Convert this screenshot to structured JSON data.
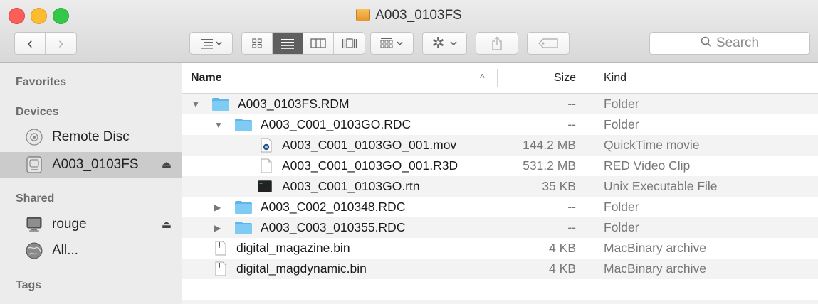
{
  "window": {
    "title": "A003_0103FS"
  },
  "toolbar": {
    "search_placeholder": "Search"
  },
  "sidebar": {
    "favorites_header": "Favorites",
    "devices_header": "Devices",
    "devices": [
      {
        "label": "Remote Disc"
      },
      {
        "label": "A003_0103FS",
        "eject": "⏏"
      }
    ],
    "shared_header": "Shared",
    "shared": [
      {
        "label": "rouge",
        "eject": "⏏"
      },
      {
        "label": "All..."
      }
    ],
    "tags_header": "Tags"
  },
  "columns": {
    "name": "Name",
    "size": "Size",
    "kind": "Kind",
    "sort_indicator": "^"
  },
  "rows": [
    {
      "name": "A003_0103FS.RDM",
      "size": "--",
      "kind": "Folder"
    },
    {
      "name": "A003_C001_0103GO.RDC",
      "size": "--",
      "kind": "Folder"
    },
    {
      "name": "A003_C001_0103GO_001.mov",
      "size": "144.2 MB",
      "kind": "QuickTime movie"
    },
    {
      "name": "A003_C001_0103GO_001.R3D",
      "size": "531.2 MB",
      "kind": "RED Video Clip"
    },
    {
      "name": "A003_C001_0103GO.rtn",
      "size": "35 KB",
      "kind": "Unix Executable File"
    },
    {
      "name": "A003_C002_010348.RDC",
      "size": "--",
      "kind": "Folder"
    },
    {
      "name": "A003_C003_010355.RDC",
      "size": "--",
      "kind": "Folder"
    },
    {
      "name": "digital_magazine.bin",
      "size": "4 KB",
      "kind": "MacBinary archive"
    },
    {
      "name": "digital_magdynamic.bin",
      "size": "4 KB",
      "kind": "MacBinary archive"
    }
  ]
}
